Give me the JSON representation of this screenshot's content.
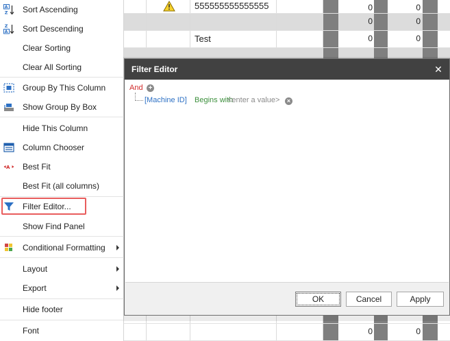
{
  "menu": {
    "items": [
      {
        "label": "Sort Ascending",
        "icon": "sort-ascending-icon"
      },
      {
        "label": "Sort Descending",
        "icon": "sort-descending-icon"
      },
      {
        "label": "Clear Sorting",
        "icon": ""
      },
      {
        "label": "Clear All Sorting",
        "icon": ""
      },
      {
        "label": "Group By This Column",
        "icon": "group-by-column-icon"
      },
      {
        "label": "Show Group By Box",
        "icon": "group-by-box-icon"
      },
      {
        "label": "Hide This Column",
        "icon": ""
      },
      {
        "label": "Column Chooser",
        "icon": "column-chooser-icon"
      },
      {
        "label": "Best Fit",
        "icon": "best-fit-icon"
      },
      {
        "label": "Best Fit (all columns)",
        "icon": ""
      },
      {
        "label": "Filter Editor...",
        "icon": "filter-icon"
      },
      {
        "label": "Show Find Panel",
        "icon": ""
      },
      {
        "label": "Conditional Formatting",
        "icon": "conditional-formatting-icon",
        "submenu": true
      },
      {
        "label": "Layout",
        "icon": "",
        "submenu": true
      },
      {
        "label": "Export",
        "icon": "",
        "submenu": true
      },
      {
        "label": "Hide footer",
        "icon": ""
      },
      {
        "label": "Font",
        "icon": ""
      }
    ]
  },
  "grid": {
    "row1_text": "555555555555555",
    "row3_text": "Test",
    "zero": "0",
    "warning_icon": "warning-icon"
  },
  "dialog": {
    "title": "Filter Editor",
    "close_glyph": "✕",
    "root_operator": "And",
    "condition": {
      "field": "[Machine ID]",
      "operator": "Begins with",
      "value": "<enter a value>"
    },
    "ok_label": "OK",
    "cancel_label": "Cancel",
    "apply_label": "Apply"
  },
  "colors": {
    "highlight_border": "#e85c5c",
    "dialog_title_bg": "#414141",
    "and_color": "#d02a2a",
    "field_color": "#2c70c4",
    "operator_color": "#3c8f3c"
  }
}
